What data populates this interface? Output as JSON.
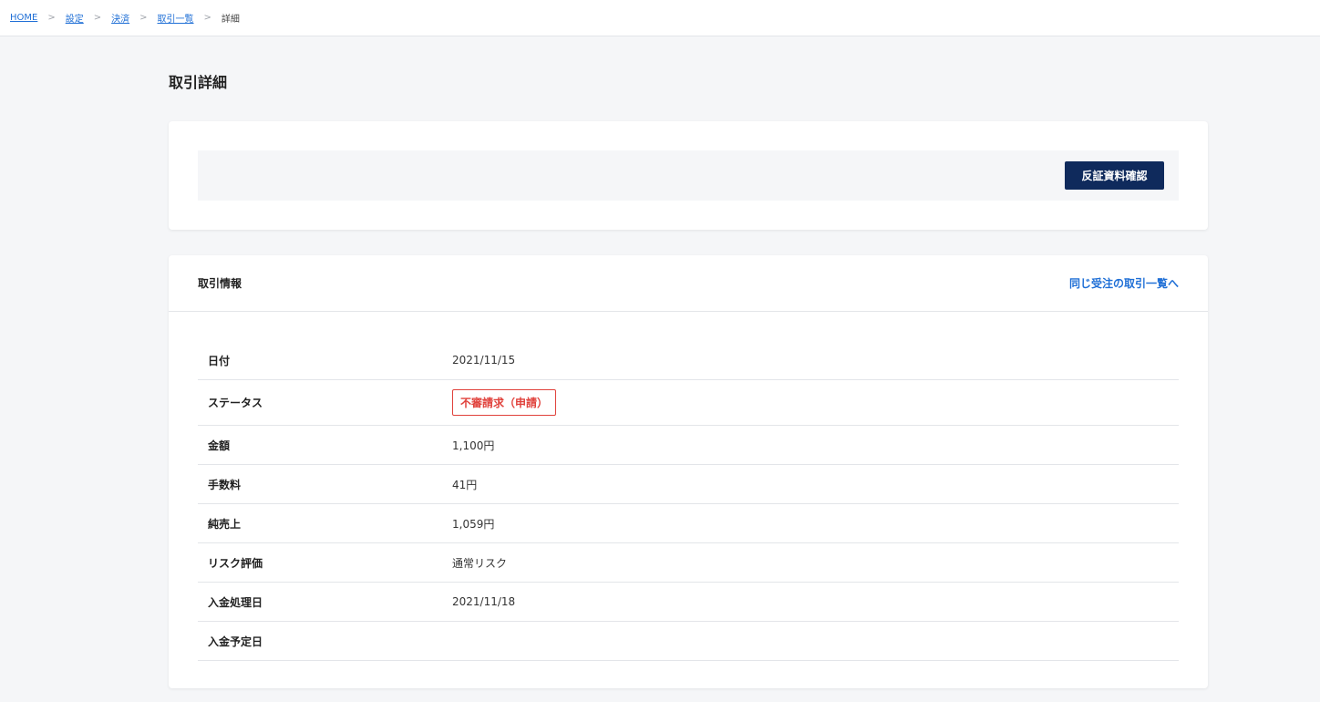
{
  "breadcrumb": {
    "items": [
      {
        "label": "HOME"
      },
      {
        "label": "設定"
      },
      {
        "label": "決済"
      },
      {
        "label": "取引一覧"
      }
    ],
    "current": "詳細",
    "separator": ">"
  },
  "page": {
    "title": "取引詳細"
  },
  "actions": {
    "primary_button": "反証資料確認"
  },
  "info": {
    "title": "取引情報",
    "link": "同じ受注の取引一覧へ",
    "rows": [
      {
        "label": "日付",
        "value": "2021/11/15"
      },
      {
        "label": "ステータス",
        "value": "不審請求（申請）"
      },
      {
        "label": "金額",
        "value": "1,100円"
      },
      {
        "label": "手数料",
        "value": "41円"
      },
      {
        "label": "純売上",
        "value": "1,059円"
      },
      {
        "label": "リスク評価",
        "value": "通常リスク"
      },
      {
        "label": "入金処理日",
        "value": "2021/11/18"
      },
      {
        "label": "入金予定日",
        "value": ""
      }
    ]
  },
  "colors": {
    "primary": "#0f2a5c",
    "link": "#1f6fd6",
    "danger": "#e0413b",
    "background": "#f5f6f8"
  }
}
